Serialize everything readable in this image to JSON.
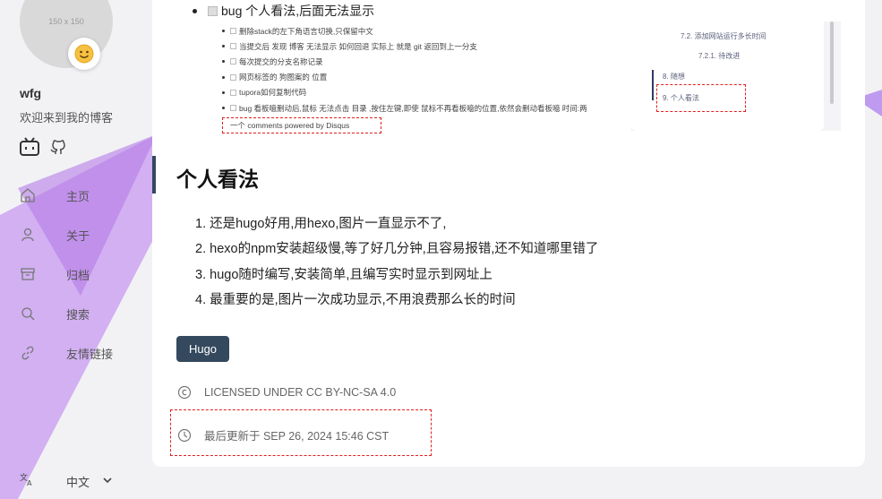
{
  "sidebar": {
    "avatar_text": "150 x 150",
    "site_name": "wfg",
    "site_desc": "欢迎来到我的博客",
    "menu": [
      {
        "label": "主页",
        "icon": "home-icon"
      },
      {
        "label": "关于",
        "icon": "user-icon"
      },
      {
        "label": "归档",
        "icon": "archive-icon"
      },
      {
        "label": "搜索",
        "icon": "search-icon"
      },
      {
        "label": "友情链接",
        "icon": "link-icon"
      }
    ],
    "language": "中文"
  },
  "article": {
    "top_item": "bug 个人看法,后面无法显示",
    "sub_items": [
      "删除stack的左下角语言切换,只保留中文",
      "当提交后 发现 博客 无法显示 如何回退 实际上 就是 git 返回到上一分支",
      "每次提交的分支名称记录",
      "网页标签的 狗图案的 位置",
      "tupora如何复制代码",
      "bug 看板噫删动后,鼠标 无法点击 目录 ,按住左键,即使 鼠标不再看板噫的位置,依然会删动看板噫 时间:两"
    ],
    "disqus_text": "一个 comments powered by Disqus",
    "embedded_toc": [
      "7.2. 添加网站运行多长时间",
      "7.2.1. 待改进",
      "8. 随想",
      "9. 个人看法"
    ],
    "heading": "个人看法",
    "points": [
      "还是hugo好用,用hexo,图片一直显示不了,",
      "hexo的npm安装超级慢,等了好几分钟,且容易报错,还不知道哪里错了",
      "hugo随时编写,安装简单,且编写实时显示到网址上",
      "最重要的是,图片一次成功显示,不用浪费那么长的时间"
    ],
    "point_numbers": [
      "1.",
      "2.",
      "3.",
      "4."
    ],
    "tag": "Hugo",
    "license": "LICENSED UNDER CC BY-NC-SA 4.0",
    "updated": "最后更新于 SEP 26, 2024 15:46 CST"
  },
  "colors": {
    "accent": "#34495e",
    "annotation_red": "#e02020",
    "background": "#f2f2f5",
    "shape_purple": "#b87ce8"
  }
}
